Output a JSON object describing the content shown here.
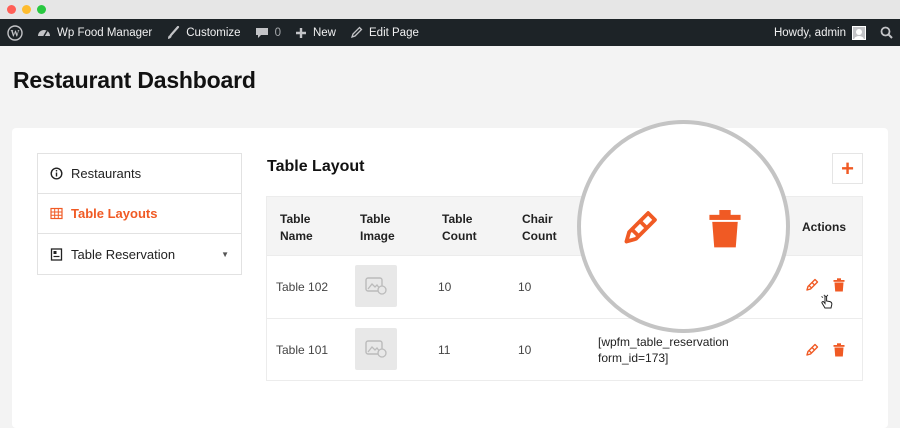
{
  "adminbar": {
    "site_name": "Wp Food Manager",
    "customize": "Customize",
    "comments_count": "0",
    "new_label": "New",
    "edit_page": "Edit Page",
    "greeting": "Howdy, admin"
  },
  "page": {
    "title": "Restaurant Dashboard"
  },
  "sidebar": {
    "items": [
      {
        "label": "Restaurants",
        "icon": "info-icon"
      },
      {
        "label": "Table Layouts",
        "icon": "table-grid-icon",
        "active": true
      },
      {
        "label": "Table Reservation",
        "icon": "reservation-icon"
      }
    ]
  },
  "main": {
    "section_title": "Table Layout",
    "add_label": "+",
    "columns": [
      "Table Name",
      "Table Image",
      "Table Count",
      "Chair Count",
      "Actions"
    ],
    "rows": [
      {
        "name": "Table 102",
        "table_count": "10",
        "chair_count": "10",
        "shortcode": ""
      },
      {
        "name": "Table 101",
        "table_count": "11",
        "chair_count": "10",
        "shortcode": "[wpfm_table_reservation form_id=173]"
      }
    ]
  },
  "colors": {
    "accent": "#f05a24",
    "adminbar": "#1d2327"
  }
}
